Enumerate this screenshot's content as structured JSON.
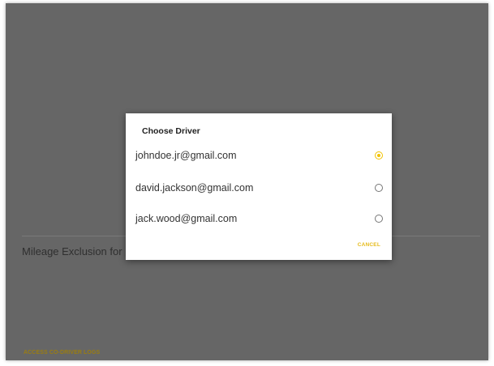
{
  "background": {
    "mileage_label": "Mileage Exclusion for",
    "access_link": "ACCESS CO-DRIVER LOGS"
  },
  "dialog": {
    "title": "Choose Driver",
    "options": [
      {
        "label": "johndoe.jr@gmail.com",
        "selected": true
      },
      {
        "label": "david.jackson@gmail.com",
        "selected": false
      },
      {
        "label": "jack.wood@gmail.com",
        "selected": false
      }
    ],
    "cancel_label": "CANCEL"
  },
  "colors": {
    "accent": "#f2c200",
    "scrim": "#666666"
  }
}
